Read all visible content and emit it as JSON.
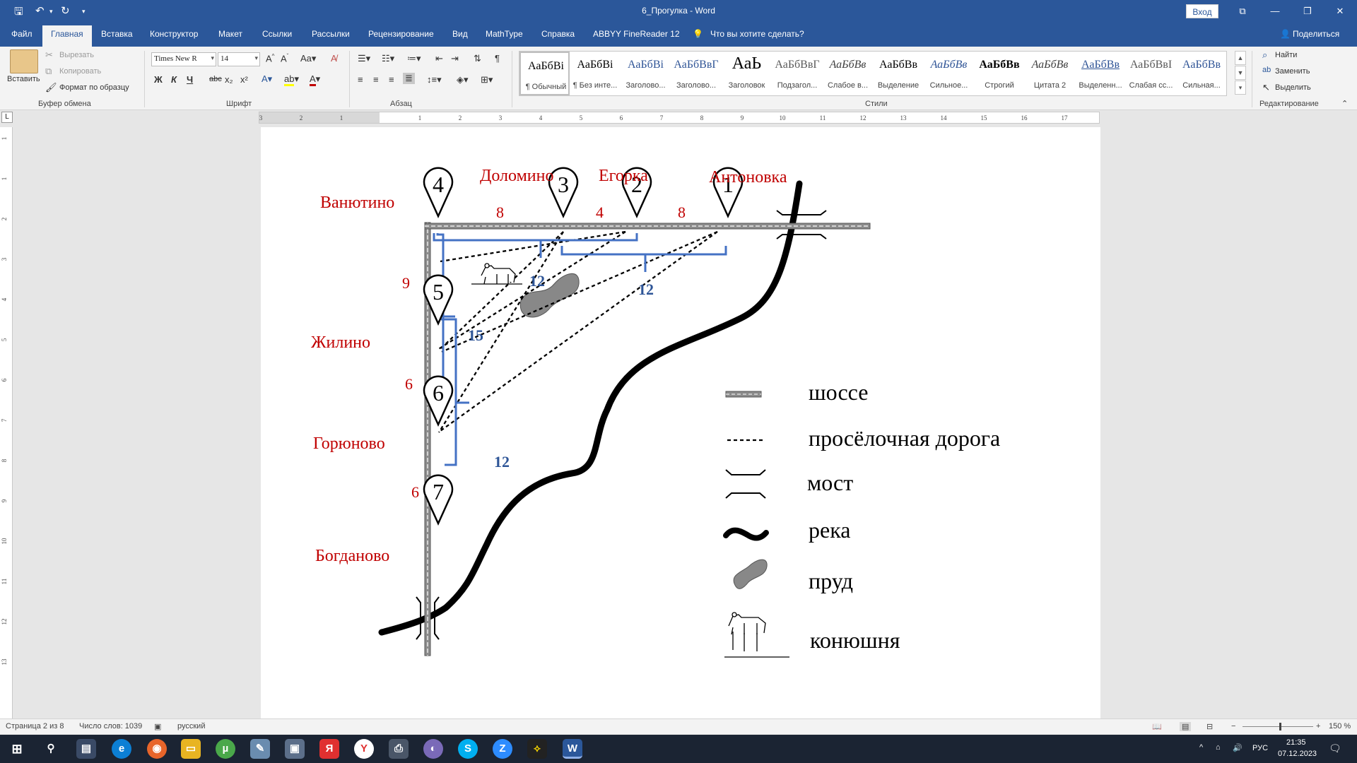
{
  "window": {
    "title": "6_Прогулка - Word",
    "signin_label": "Вход"
  },
  "tabs": [
    "Файл",
    "Главная",
    "Вставка",
    "Конструктор",
    "Макет",
    "Ссылки",
    "Рассылки",
    "Рецензирование",
    "Вид",
    "MathType",
    "Справка",
    "ABBYY FineReader 12"
  ],
  "tell_me": "Что вы хотите сделать?",
  "share_label": "Поделиться",
  "clipboard": {
    "paste": "Вставить",
    "cut": "Вырезать",
    "copy": "Копировать",
    "format_painter": "Формат по образцу",
    "group": "Буфер обмена"
  },
  "font": {
    "name": "Times New R",
    "size": "14",
    "group": "Шрифт",
    "bold": "Ж",
    "italic": "К",
    "underline": "Ч",
    "strike": "abc",
    "sub": "x₂",
    "sup": "x²"
  },
  "paragraph": {
    "group": "Абзац"
  },
  "styles": {
    "group": "Стили",
    "items": [
      {
        "preview": "АаБбВі",
        "name": "¶ Обычный"
      },
      {
        "preview": "АаБбВі",
        "name": "¶ Без инте..."
      },
      {
        "preview": "АаБбВі",
        "name": "Заголово..."
      },
      {
        "preview": "АаБбВвГ",
        "name": "Заголово..."
      },
      {
        "preview": "АаЬ",
        "name": "Заголовок"
      },
      {
        "preview": "АаБбВвГ",
        "name": "Подзагол..."
      },
      {
        "preview": "АаБбВв",
        "name": "Слабое в..."
      },
      {
        "preview": "АаБбВв",
        "name": "Выделение"
      },
      {
        "preview": "АаБбВв",
        "name": "Сильное..."
      },
      {
        "preview": "АаБбВв",
        "name": "Строгий"
      },
      {
        "preview": "АаБбВв",
        "name": "Цитата 2"
      },
      {
        "preview": "АаБбВв",
        "name": "Выделенн..."
      },
      {
        "preview": "АаБбВвІ",
        "name": "Слабая сс..."
      },
      {
        "preview": "АаБбВв",
        "name": "Сильная..."
      }
    ]
  },
  "editing": {
    "find": "Найти",
    "replace": "Заменить",
    "select": "Выделить",
    "group": "Редактирование"
  },
  "ruler": {
    "h_numbers": [
      "3",
      "2",
      "1",
      "1",
      "2",
      "3",
      "4",
      "5",
      "6",
      "7",
      "8",
      "9",
      "10",
      "11",
      "12",
      "13",
      "14",
      "15",
      "16",
      "17"
    ],
    "v_numbers": [
      "1",
      "1",
      "2",
      "3",
      "4",
      "5",
      "6",
      "7",
      "8",
      "9",
      "10",
      "11",
      "12",
      "13"
    ]
  },
  "map": {
    "villages": [
      {
        "num": "4",
        "name": "Ванютино"
      },
      {
        "num": "3",
        "name": "Доломино"
      },
      {
        "num": "2",
        "name": "Егорка"
      },
      {
        "num": "1",
        "name": "Антоновка"
      },
      {
        "num": "5",
        "name": "Жилино"
      },
      {
        "num": "6",
        "name": "Горюново"
      },
      {
        "num": "7",
        "name": "Богданово"
      }
    ],
    "road_distances": {
      "d43": "8",
      "d32": "4",
      "d21": "8",
      "d45": "9",
      "d56": "6",
      "d67": "6"
    },
    "brace_distances": {
      "b_top1": "12",
      "b_top2": "12",
      "b_side1": "15",
      "b_side2": "12"
    },
    "legend": [
      {
        "symbol": "highway",
        "label": "шоссе"
      },
      {
        "symbol": "dirt-road",
        "label": "просёлочная дорога"
      },
      {
        "symbol": "bridge",
        "label": "мост"
      },
      {
        "symbol": "river",
        "label": "река"
      },
      {
        "symbol": "pond",
        "label": "пруд"
      },
      {
        "symbol": "stable",
        "label": "конюшня"
      }
    ],
    "colors": {
      "names": "#c00000",
      "numbers": "#c00000",
      "braces": "#4472c4",
      "brace_numbers": "#2e5597"
    }
  },
  "status": {
    "page": "Страница 2 из 8",
    "words": "Число слов: 1039",
    "language": "русский",
    "zoom": "150 %"
  },
  "taskbar": {
    "lang": "РУС",
    "time": "21:35",
    "date": "07.12.2023"
  }
}
